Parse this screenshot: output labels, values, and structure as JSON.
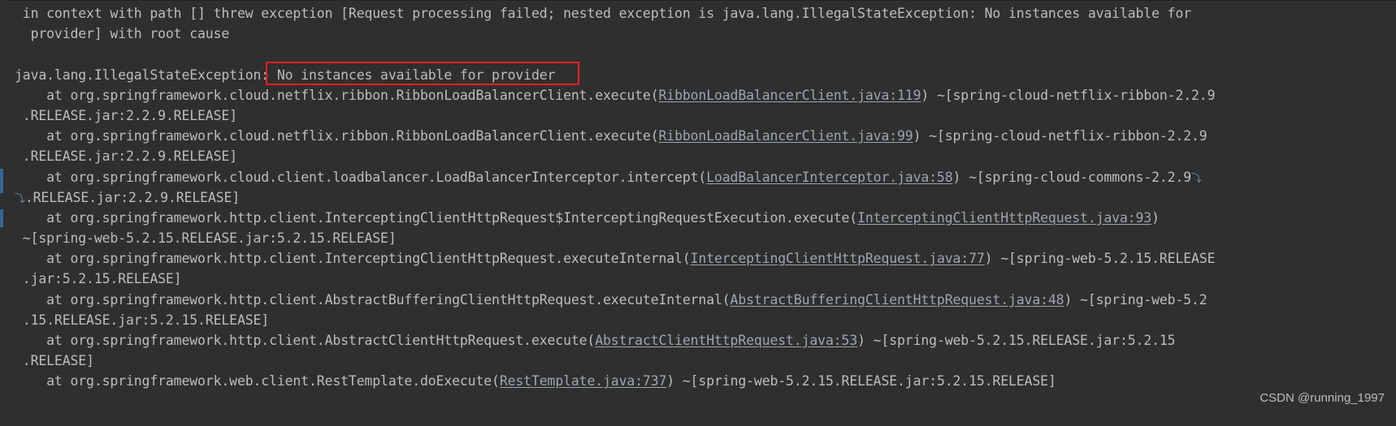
{
  "console": {
    "title": "Console stacktrace output",
    "background_color": "#2f2f2f",
    "text_color": "#bdbdbd",
    "link_color": "#9aa7b0",
    "highlight_color": "#ff1f1f",
    "wrap_glyph": "⤵",
    "watermark": "CSDN @running_1997",
    "highlighted_text": "No instances available for provider",
    "lines": [
      {
        "id": "line-1",
        "segments": [
          {
            "text": " in context with path [] threw exception [Request processing failed; nested exception is java.lang.IllegalStateException: No instances available for",
            "link": false
          }
        ]
      },
      {
        "id": "line-2",
        "segments": [
          {
            "text": "  provider] with root cause",
            "link": false
          }
        ]
      },
      {
        "id": "line-3",
        "segments": [
          {
            "text": "",
            "link": false
          }
        ]
      },
      {
        "id": "line-4",
        "segments": [
          {
            "text": "java.lang.IllegalStateException: No instances available for provider",
            "link": false
          }
        ]
      },
      {
        "id": "line-5",
        "segments": [
          {
            "text": "    at org.springframework.cloud.netflix.ribbon.RibbonLoadBalancerClient.execute(",
            "link": false
          },
          {
            "text": "RibbonLoadBalancerClient.java:119",
            "link": true
          },
          {
            "text": ") ~[spring-cloud-netflix-ribbon-2.2.9",
            "link": false
          }
        ]
      },
      {
        "id": "line-6",
        "segments": [
          {
            "text": " .RELEASE.jar:2.2.9.RELEASE]",
            "link": false
          }
        ]
      },
      {
        "id": "line-7",
        "segments": [
          {
            "text": "    at org.springframework.cloud.netflix.ribbon.RibbonLoadBalancerClient.execute(",
            "link": false
          },
          {
            "text": "RibbonLoadBalancerClient.java:99",
            "link": true
          },
          {
            "text": ") ~[spring-cloud-netflix-ribbon-2.2.9",
            "link": false
          }
        ]
      },
      {
        "id": "line-8",
        "segments": [
          {
            "text": " .RELEASE.jar:2.2.9.RELEASE]",
            "link": false
          }
        ]
      },
      {
        "id": "line-9",
        "segments": [
          {
            "text": "    at org.springframework.cloud.client.loadbalancer.LoadBalancerInterceptor.intercept(",
            "link": false
          },
          {
            "text": "LoadBalancerInterceptor.java:58",
            "link": true
          },
          {
            "text": ") ~[spring-cloud-commons-2.2.9",
            "link": false
          },
          {
            "text": "⤵",
            "link": false,
            "wrap": true
          }
        ]
      },
      {
        "id": "line-10",
        "wrap_start": true,
        "segments": [
          {
            "text": "⤵",
            "link": false,
            "wrap": true
          },
          {
            "text": ".RELEASE.jar:2.2.9.RELEASE]",
            "link": false
          }
        ]
      },
      {
        "id": "line-11",
        "segments": [
          {
            "text": "    at org.springframework.http.client.InterceptingClientHttpRequest$InterceptingRequestExecution.execute(",
            "link": false
          },
          {
            "text": "InterceptingClientHttpRequest.java:93",
            "link": true
          },
          {
            "text": ")",
            "link": false
          }
        ]
      },
      {
        "id": "line-12",
        "segments": [
          {
            "text": " ~[spring-web-5.2.15.RELEASE.jar:5.2.15.RELEASE]",
            "link": false
          }
        ]
      },
      {
        "id": "line-13",
        "segments": [
          {
            "text": "    at org.springframework.http.client.InterceptingClientHttpRequest.executeInternal(",
            "link": false
          },
          {
            "text": "InterceptingClientHttpRequest.java:77",
            "link": true
          },
          {
            "text": ") ~[spring-web-5.2.15.RELEASE",
            "link": false
          }
        ]
      },
      {
        "id": "line-14",
        "segments": [
          {
            "text": " .jar:5.2.15.RELEASE]",
            "link": false
          }
        ]
      },
      {
        "id": "line-15",
        "segments": [
          {
            "text": "    at org.springframework.http.client.AbstractBufferingClientHttpRequest.executeInternal(",
            "link": false
          },
          {
            "text": "AbstractBufferingClientHttpRequest.java:48",
            "link": true
          },
          {
            "text": ") ~[spring-web-5.2",
            "link": false
          }
        ]
      },
      {
        "id": "line-16",
        "segments": [
          {
            "text": " .15.RELEASE.jar:5.2.15.RELEASE]",
            "link": false
          }
        ]
      },
      {
        "id": "line-17",
        "segments": [
          {
            "text": "    at org.springframework.http.client.AbstractClientHttpRequest.execute(",
            "link": false
          },
          {
            "text": "AbstractClientHttpRequest.java:53",
            "link": true
          },
          {
            "text": ") ~[spring-web-5.2.15.RELEASE.jar:5.2.15",
            "link": false
          }
        ]
      },
      {
        "id": "line-18",
        "segments": [
          {
            "text": " .RELEASE]",
            "link": false
          }
        ]
      },
      {
        "id": "line-19",
        "segments": [
          {
            "text": "    at org.springframework.web.client.RestTemplate.doExecute(",
            "link": false
          },
          {
            "text": "RestTemplate.java:737",
            "link": true
          },
          {
            "text": ") ~[spring-web-5.2.15.RELEASE.jar:5.2.15.RELEASE]",
            "link": false
          }
        ]
      }
    ]
  }
}
